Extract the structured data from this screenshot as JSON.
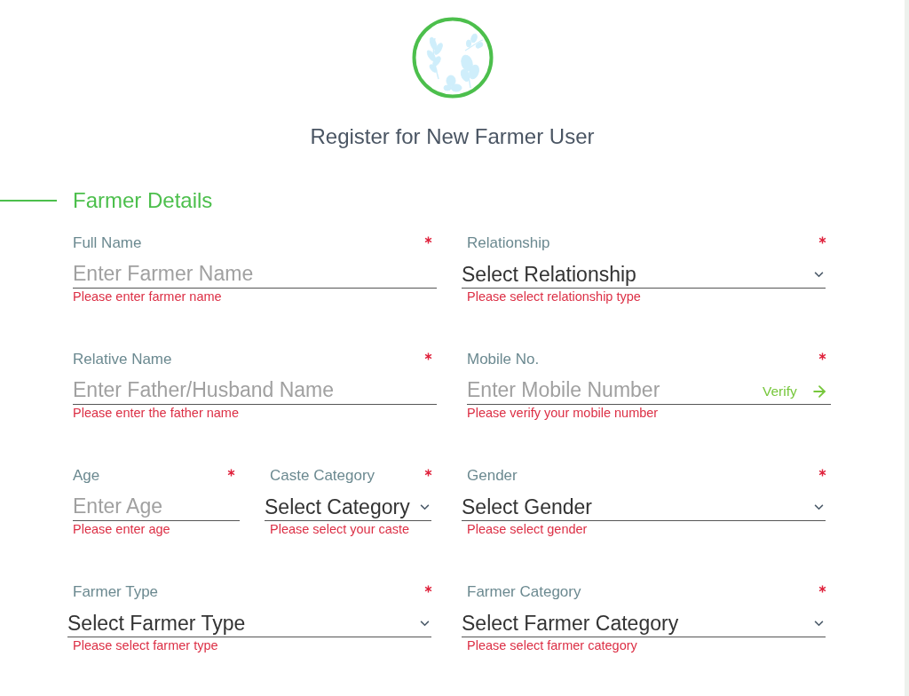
{
  "title": "Register for New Farmer User",
  "section": {
    "title": "Farmer Details",
    "rows": [
      {
        "columns": [
          [
            {
              "kind": "text",
              "label": "Full Name",
              "required": true,
              "placeholder": "Enter Farmer Name",
              "error": "Please enter farmer name"
            }
          ],
          [
            {
              "kind": "select",
              "label": "Relationship",
              "required": true,
              "value": "Select Relationship",
              "error": "Please select relationship type"
            }
          ]
        ]
      },
      {
        "columns": [
          [
            {
              "kind": "text",
              "label": "Relative Name",
              "required": true,
              "placeholder": "Enter Father/Husband Name",
              "error": "Please enter the father name"
            }
          ],
          [
            {
              "kind": "verify",
              "label": "Mobile No.",
              "required": true,
              "placeholder": "Enter Mobile Number",
              "action": "Verify",
              "error": "Please verify your mobile number"
            }
          ]
        ]
      },
      {
        "columns": [
          [
            {
              "kind": "text",
              "label": "Age",
              "required": true,
              "placeholder": "Enter Age",
              "error": "Please enter age"
            },
            {
              "kind": "select",
              "label": "Caste Category",
              "required": true,
              "value": "Select Category",
              "error": "Please select your caste"
            }
          ],
          [
            {
              "kind": "select",
              "label": "Gender",
              "required": true,
              "value": "Select Gender",
              "error": "Please select gender"
            }
          ]
        ]
      },
      {
        "columns": [
          [
            {
              "kind": "select",
              "label": "Farmer Type",
              "required": true,
              "value": "Select Farmer Type",
              "error": "Please select farmer type"
            }
          ],
          [
            {
              "kind": "select",
              "label": "Farmer Category",
              "required": true,
              "value": "Select Farmer Category",
              "error": "Please select farmer category"
            }
          ]
        ]
      }
    ]
  }
}
